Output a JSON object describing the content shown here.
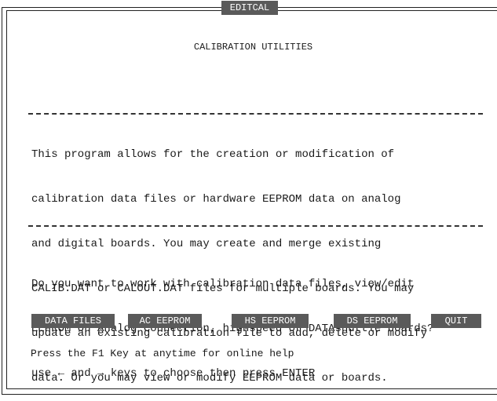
{
  "window": {
    "title": "EDITCAL"
  },
  "heading": "CALIBRATION UTILITIES",
  "description": [
    "This program allows for the creation or modification of",
    "calibration data files or hardware EEPROM data on analog",
    "and digital boards. You may create and merge existing",
    "CALIB.DAT or CALOUT.DAT files for multiple boards. You may",
    "update an existing calibration file to add, delete or modify",
    "data. Or you may view or modify EEPROM data or boards."
  ],
  "prompt": [
    "Do you want to work with calibration data files, view/edit",
    "EEPROM on Analog Connection, highspeed or DATAshuttle boards?",
    "use ← and → keys to choose then press ENTER"
  ],
  "buttons": {
    "data_files": "DATA FILES",
    "ac_eeprom": "AC EEPROM",
    "hs_eeprom": "HS EEPROM",
    "ds_eeprom": "DS EEPROM",
    "quit": "QUIT"
  },
  "help_text": "Press the F1 Key at anytime for online help",
  "colors": {
    "button_bg": "#5a5a5a",
    "button_fg": "#ffffff",
    "text": "#1a1a1a",
    "background": "#ffffff"
  }
}
